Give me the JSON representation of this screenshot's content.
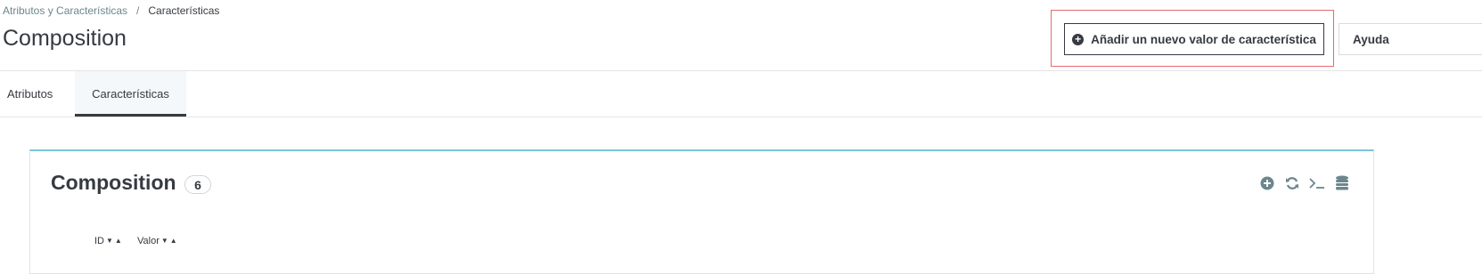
{
  "breadcrumb": {
    "parent": "Atributos y Características",
    "separator": "/",
    "current": "Características"
  },
  "page_title": "Composition",
  "toolbar": {
    "add_label": "Añadir un nuevo valor de característica",
    "help_label": "Ayuda"
  },
  "tabs": [
    {
      "label": "Atributos"
    },
    {
      "label": "Características"
    }
  ],
  "panel": {
    "title": "Composition",
    "count": "6",
    "columns": [
      {
        "label": "ID"
      },
      {
        "label": "Valor"
      }
    ]
  },
  "icons": [
    "plus-circle-icon",
    "refresh-icon",
    "terminal-icon",
    "database-icon",
    "caret-down-icon",
    "caret-up-icon"
  ],
  "colors": {
    "text": "#363a41",
    "muted": "#6c868e",
    "highlight": "#e36c72",
    "panel_top": "#7cc4d8",
    "active_tab_bg": "#f4f8fb"
  }
}
